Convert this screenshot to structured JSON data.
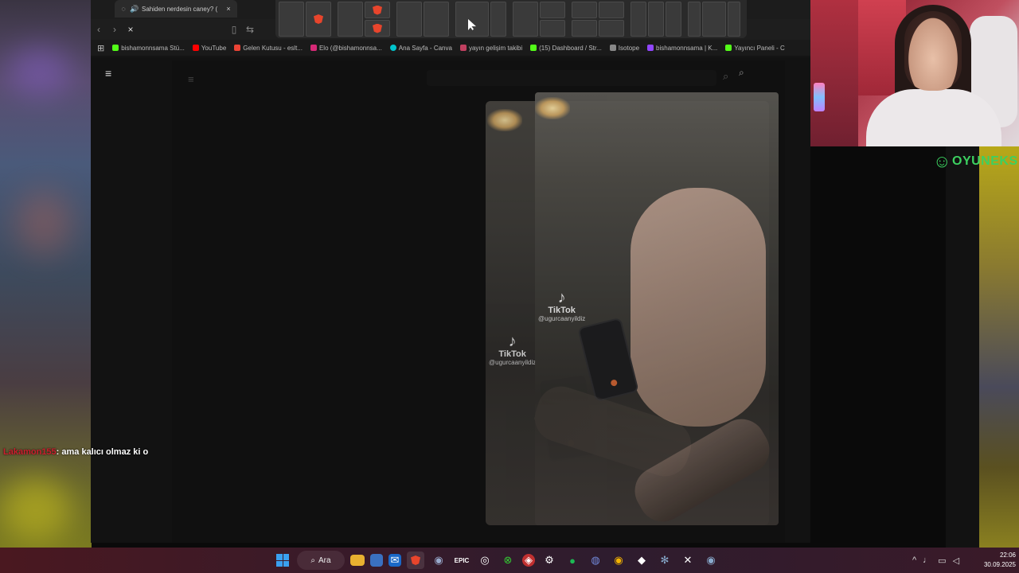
{
  "browser": {
    "tab": {
      "title": "Sahiden nerdesin caney? ("
    },
    "bookmarks": [
      {
        "label": "bishamonnsama Stü...",
        "color": "#53fc18"
      },
      {
        "label": "YouTube",
        "color": "#ff0000"
      },
      {
        "label": "Gelen Kutusu - eslt...",
        "color": "#ea4335"
      },
      {
        "label": "Elo (@bishamonnsa...",
        "color": "#d62976"
      },
      {
        "label": "Ana Sayfa - Canva",
        "color": "#00c4cc"
      },
      {
        "label": "yayın gelişim takibi",
        "color": "#c04060"
      },
      {
        "label": "(15) Dashboard / Str...",
        "color": "#53fc18"
      },
      {
        "label": "Isotope",
        "color": "#888888"
      },
      {
        "label": "bishamonnsama | K...",
        "color": "#9146ff"
      },
      {
        "label": "Yayıncı Paneli - C",
        "color": "#53fc18"
      }
    ]
  },
  "video": {
    "watermark_front": {
      "brand": "TikTok",
      "user": "@ugurcaanyildiz"
    },
    "watermark_back": {
      "brand": "TikTok",
      "user": "@ugurcaanyildiz"
    }
  },
  "chat": {
    "user": "Lakamon155",
    "message": ": ama kalıcı olmaz ki o"
  },
  "overlay": {
    "brand": "OYUNEKS"
  },
  "taskbar": {
    "search_label": "Ara",
    "time": "22:06",
    "date": "30.09.2025"
  },
  "icons": {
    "tab_close": "×",
    "reload": "×",
    "hamburger": "≡",
    "search": "⌕",
    "tiktok": "♪"
  }
}
